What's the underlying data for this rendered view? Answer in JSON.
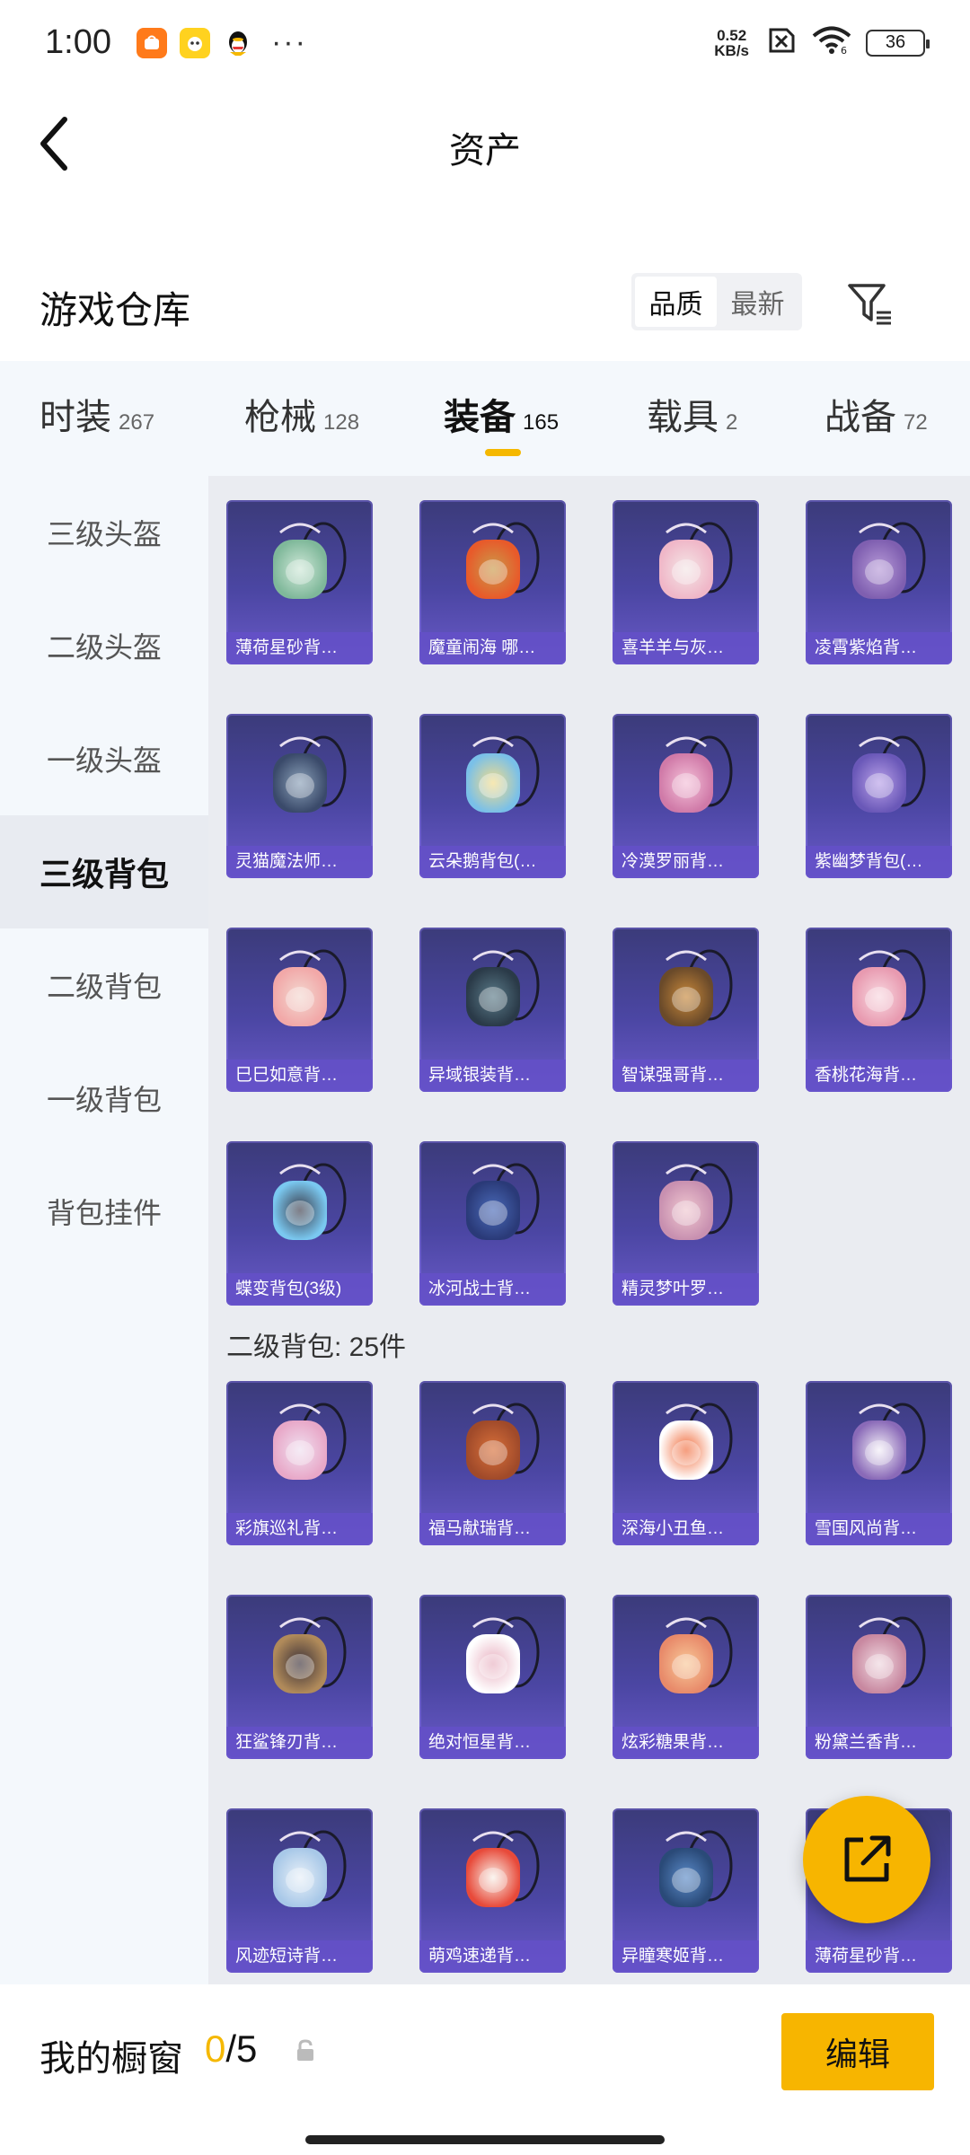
{
  "status_bar": {
    "time": "1:00",
    "net_speed_value": "0.52",
    "net_speed_unit": "KB/s",
    "battery": "36",
    "app_badges": [
      "taobao-icon",
      "yellow-app-icon",
      "qq-penguin-icon"
    ]
  },
  "header": {
    "title": "资产"
  },
  "section": {
    "title": "游戏仓库",
    "sort_quality": "品质",
    "sort_newest": "最新",
    "active_sort": "品质"
  },
  "tabs": [
    {
      "label": "时装",
      "count": "267"
    },
    {
      "label": "枪械",
      "count": "128"
    },
    {
      "label": "装备",
      "count": "165"
    },
    {
      "label": "载具",
      "count": "2"
    },
    {
      "label": "战备",
      "count": "72"
    }
  ],
  "active_tab": "装备",
  "sidebar": [
    {
      "label": "三级头盔"
    },
    {
      "label": "二级头盔"
    },
    {
      "label": "一级头盔"
    },
    {
      "label": "三级背包"
    },
    {
      "label": "二级背包"
    },
    {
      "label": "一级背包"
    },
    {
      "label": "背包挂件"
    }
  ],
  "active_sidebar": "三级背包",
  "level3_items": [
    {
      "name": "薄荷星砂背…"
    },
    {
      "name": "魔童闹海 哪…"
    },
    {
      "name": "喜羊羊与灰…"
    },
    {
      "name": "凌霄紫焰背…"
    },
    {
      "name": "灵猫魔法师…"
    },
    {
      "name": "云朵鹅背包(…"
    },
    {
      "name": "冷漠罗丽背…"
    },
    {
      "name": "紫幽梦背包(…"
    },
    {
      "name": "巳巳如意背…"
    },
    {
      "name": "异域银装背…"
    },
    {
      "name": "智谋强哥背…"
    },
    {
      "name": "香桃花海背…"
    },
    {
      "name": "蝶变背包(3级)"
    },
    {
      "name": "冰河战士背…"
    },
    {
      "name": "精灵梦叶罗…"
    }
  ],
  "level2_group_title": "二级背包: 25件",
  "level2_items": [
    {
      "name": "彩旗巡礼背…"
    },
    {
      "name": "福马献瑞背…"
    },
    {
      "name": "深海小丑鱼…"
    },
    {
      "name": "雪国风尚背…"
    },
    {
      "name": "狂鲨锋刃背…"
    },
    {
      "name": "绝对恒星背…"
    },
    {
      "name": "炫彩糖果背…"
    },
    {
      "name": "粉黛兰香背…"
    },
    {
      "name": "风迹短诗背…"
    },
    {
      "name": "萌鸡速递背…"
    },
    {
      "name": "异瞳寒姬背…"
    },
    {
      "name": "薄荷星砂背…"
    }
  ],
  "bottom_bar": {
    "showcase_label": "我的橱窗",
    "showcase_current": "0",
    "showcase_total": "/5",
    "edit_label": "编辑"
  },
  "colors": {
    "accent": "#f7b500",
    "card_gradient_top": "#3b3b7a",
    "card_gradient_bottom": "#6a5ac8",
    "page_bg": "#f4f8fc"
  }
}
